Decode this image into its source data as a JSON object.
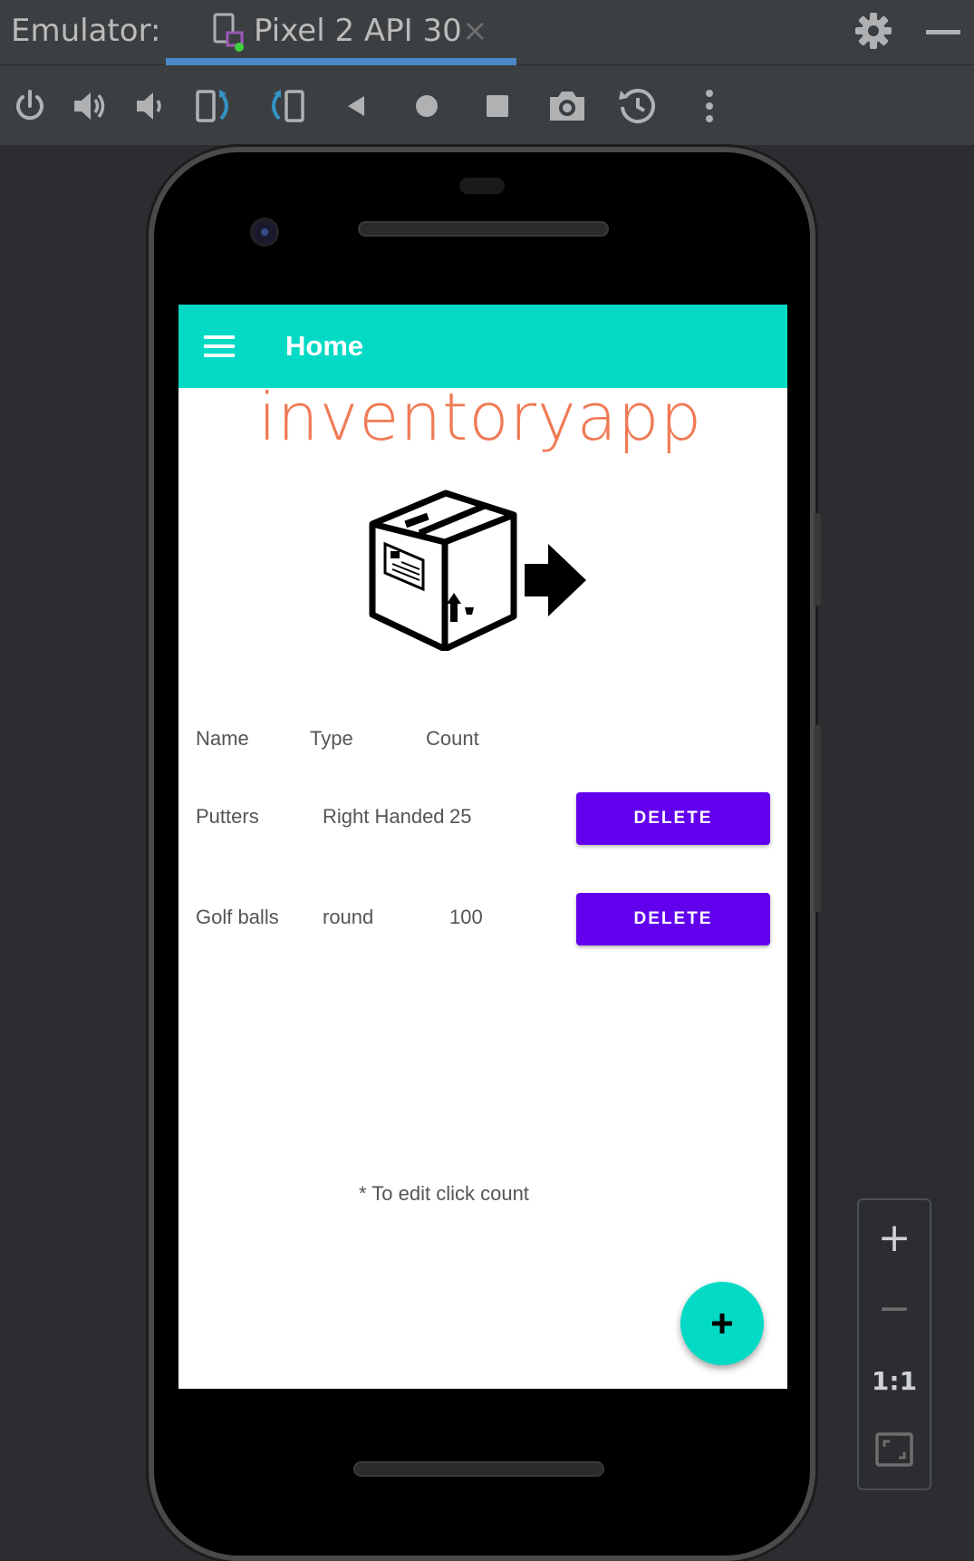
{
  "tool_window": {
    "title": "Emulator:",
    "tab_label": "Pixel 2 API 30",
    "tab_close": "×"
  },
  "toolbar": {
    "buttons": [
      "power-icon",
      "volume-up-icon",
      "volume-down-icon",
      "rotate-left-icon",
      "rotate-right-icon",
      "back-icon",
      "home-icon",
      "overview-icon",
      "screenshot-icon",
      "snapshot-icon",
      "more-icon"
    ]
  },
  "app": {
    "appbar_title": "Home",
    "logo_text": "inventoryapp",
    "columns": {
      "name": "Name",
      "type": "Type",
      "count": "Count"
    },
    "rows": [
      {
        "name": "Putters",
        "type": "Right Handed",
        "count": "25",
        "delete_label": "DELETE"
      },
      {
        "name": "Golf balls",
        "type": "round",
        "count": "100",
        "delete_label": "DELETE"
      }
    ],
    "hint": "* To edit click count",
    "fab_label": "+"
  },
  "zoom": {
    "zoom_in": "+",
    "zoom_out": "−",
    "actual_size": "1:1"
  },
  "colors": {
    "accent_teal": "#03dac5",
    "button_purple": "#6200ee",
    "logo_orange": "#f07a55",
    "ide_background": "#2b2d30"
  }
}
